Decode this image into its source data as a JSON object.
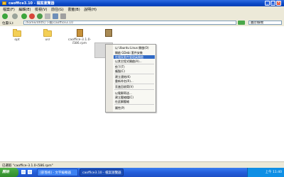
{
  "window": {
    "title": "caoffice3.10 - 檔案瀏覽器"
  },
  "menubar": {
    "items": [
      "檔案(F)",
      "編輯(E)",
      "檢視(V)",
      "前往(G)",
      "書籤(B)",
      "說明(H)"
    ]
  },
  "toolbar": {
    "icons": [
      "back-icon",
      "forward-icon",
      "up-icon",
      "stop-icon",
      "reload-icon",
      "home-icon",
      "computer-icon",
      "search-icon"
    ]
  },
  "address": {
    "label": "位置(L):",
    "value": "/home/dhtfc/下載/caoffice3.10",
    "zoom": "圖示檢視"
  },
  "files": [
    {
      "name": "opt",
      "kind": "folder"
    },
    {
      "name": "usr",
      "kind": "folder"
    },
    {
      "name": "caoffice-3.1.0-i586.rpm",
      "kind": "package"
    },
    {
      "name": "",
      "kind": "package-selected"
    }
  ],
  "context_menu": {
    "items": [
      {
        "label": "以 Ubuntu Linux 開啟(O)",
        "highlight": false
      },
      {
        "label": "開啟 GDebi 套件安裝",
        "highlight": false
      },
      {
        "label": "在檔案套件管理員開啟",
        "highlight": true
      },
      {
        "label": "以其它程式開啟(A)...",
        "highlight": false
      },
      {
        "label": "剪下(T)",
        "highlight": false
      },
      {
        "label": "複製(C)",
        "highlight": false
      },
      {
        "label": "建立連結(K)",
        "highlight": false
      },
      {
        "label": "重新命名(R)...",
        "highlight": false
      },
      {
        "label": "丟進回收筒(V)",
        "highlight": false
      },
      {
        "label": "以電郵寄送...",
        "highlight": false
      },
      {
        "label": "建立壓縮檔(C)",
        "highlight": false
      },
      {
        "label": "在此解壓縮",
        "highlight": false
      },
      {
        "label": "屬性(P)",
        "highlight": false
      }
    ]
  },
  "statusbar": {
    "text": "已選取 \"caoffice-3.1.0-i586.rpm\""
  },
  "taskbar": {
    "start": "開始",
    "tasks": [
      "[部落格] - 文字編輯器",
      "caoffice3.10 - 檔案瀏覽器"
    ],
    "clock": "上午 11:40"
  },
  "colors": {
    "titlebar": "#0a48c6",
    "highlight": "#316ac5",
    "taskbar": "#245edb"
  }
}
